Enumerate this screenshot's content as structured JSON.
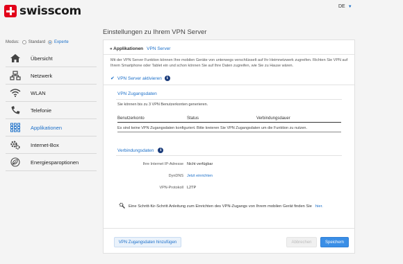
{
  "header": {
    "brand": "swisscom",
    "language": "DE"
  },
  "page": {
    "title": "Einstellungen zu Ihrem VPN Server"
  },
  "mode": {
    "label": "Modus:",
    "options": [
      "Standard",
      "Experte"
    ],
    "selected": "Experte"
  },
  "sidebar": {
    "items": [
      {
        "label": "Übersicht",
        "icon": "home-icon"
      },
      {
        "label": "Netzwerk",
        "icon": "network-icon"
      },
      {
        "label": "WLAN",
        "icon": "wifi-icon"
      },
      {
        "label": "Telefonie",
        "icon": "phone-icon"
      },
      {
        "label": "Applikationen",
        "icon": "apps-icon",
        "active": true
      },
      {
        "label": "Internet-Box",
        "icon": "gears-icon"
      },
      {
        "label": "Energiesparoptionen",
        "icon": "leaf-icon"
      }
    ]
  },
  "breadcrumb": {
    "back": "« Applikationen",
    "current": "VPN Server"
  },
  "description": "Mit der VPN Server Funktion können Ihre mobilen Geräte von unterwegs verschlüsselt auf Ihr Heimnetzwerk zugreifen. Richten Sie VPN auf Ihrem Smartphone oder Tablet ein und schon können Sie auf Ihre Daten zugreifen, wie Sie zu Hause wären.",
  "vpn_toggle": {
    "label": "VPN Server aktivieren",
    "checked": true
  },
  "credentials": {
    "title": "VPN Zugangsdaten",
    "info": "Sie können bis zu 3 VPN Benutzerkonten generieren.",
    "columns": [
      "Benutzerkonto",
      "Status",
      "Verbindungsdauer"
    ],
    "empty": "Es sind keine VPN Zugangsdaten konfiguriert. Bitte kreieren Sie VPN Zugangsdaten um die Funktion zu nutzen."
  },
  "connection": {
    "title": "Verbindungsdaten",
    "rows": [
      {
        "label": "Ihre Internet IP-Adresse",
        "value": "Nicht verfügbar"
      },
      {
        "label": "DynDNS",
        "value": "Jetzt einrichten",
        "link": true
      },
      {
        "label": "VPN-Protokoll",
        "value": "L2TP"
      }
    ]
  },
  "guide": {
    "text": "Eine Schritt-für-Schritt Anleitung zum Einrichten des VPN-Zugangs von Ihrem mobilen Gerät finden Sie",
    "link": "hier."
  },
  "buttons": {
    "add": "VPN Zugangsdaten hinzufügen",
    "cancel": "Abbrechen",
    "save": "Speichern"
  },
  "colors": {
    "accent": "#1b6fc9",
    "brand": "#e2001a"
  }
}
